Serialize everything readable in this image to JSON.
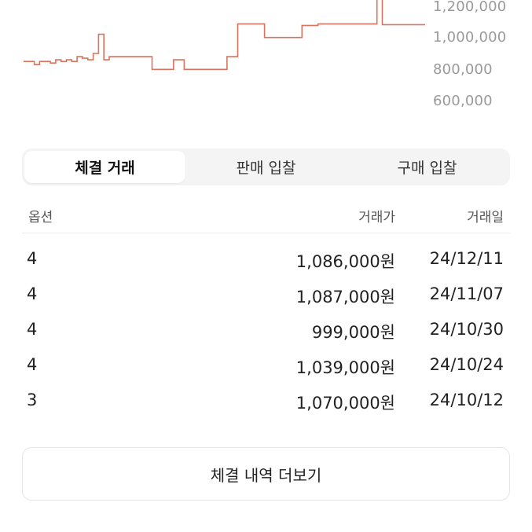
{
  "chart_data": {
    "type": "line",
    "color": "#d9735f",
    "y_ticks": [
      "1,200,000",
      "1,000,000",
      "800,000",
      "600,000"
    ],
    "ylim": [
      600000,
      1200000
    ],
    "values": [
      850000,
      850000,
      830000,
      850000,
      850000,
      840000,
      860000,
      850000,
      860000,
      850000,
      880000,
      870000,
      860000,
      900000,
      1020000,
      860000,
      880000,
      880000,
      880000,
      880000,
      880000,
      880000,
      880000,
      880000,
      800000,
      800000,
      800000,
      800000,
      860000,
      860000,
      800000,
      800000,
      800000,
      800000,
      800000,
      800000,
      800000,
      800000,
      880000,
      880000,
      1085000,
      1085000,
      1085000,
      1085000,
      1085000,
      1000000,
      1000000,
      1000000,
      1000000,
      1000000,
      1000000,
      1000000,
      1075000,
      1075000,
      1075000,
      1085000,
      1085000,
      1085000,
      1085000,
      1085000,
      1085000,
      1085000,
      1085000,
      1085000,
      1085000,
      1085000,
      1260000,
      1080000,
      1080000,
      1080000,
      1080000,
      1080000,
      1080000,
      1080000,
      1080000,
      1080000
    ]
  },
  "tabs": [
    {
      "label": "체결 거래"
    },
    {
      "label": "판매 입찰"
    },
    {
      "label": "구매 입찰"
    }
  ],
  "table": {
    "headers": {
      "option": "옵션",
      "price": "거래가",
      "date": "거래일"
    },
    "rows": [
      {
        "option": "4",
        "price": "1,086,000원",
        "date": "24/12/11"
      },
      {
        "option": "4",
        "price": "1,087,000원",
        "date": "24/11/07"
      },
      {
        "option": "4",
        "price": "999,000원",
        "date": "24/10/30"
      },
      {
        "option": "4",
        "price": "1,039,000원",
        "date": "24/10/24"
      },
      {
        "option": "3",
        "price": "1,070,000원",
        "date": "24/10/12"
      }
    ]
  },
  "more_button": {
    "label": "체결 내역 더보기"
  }
}
